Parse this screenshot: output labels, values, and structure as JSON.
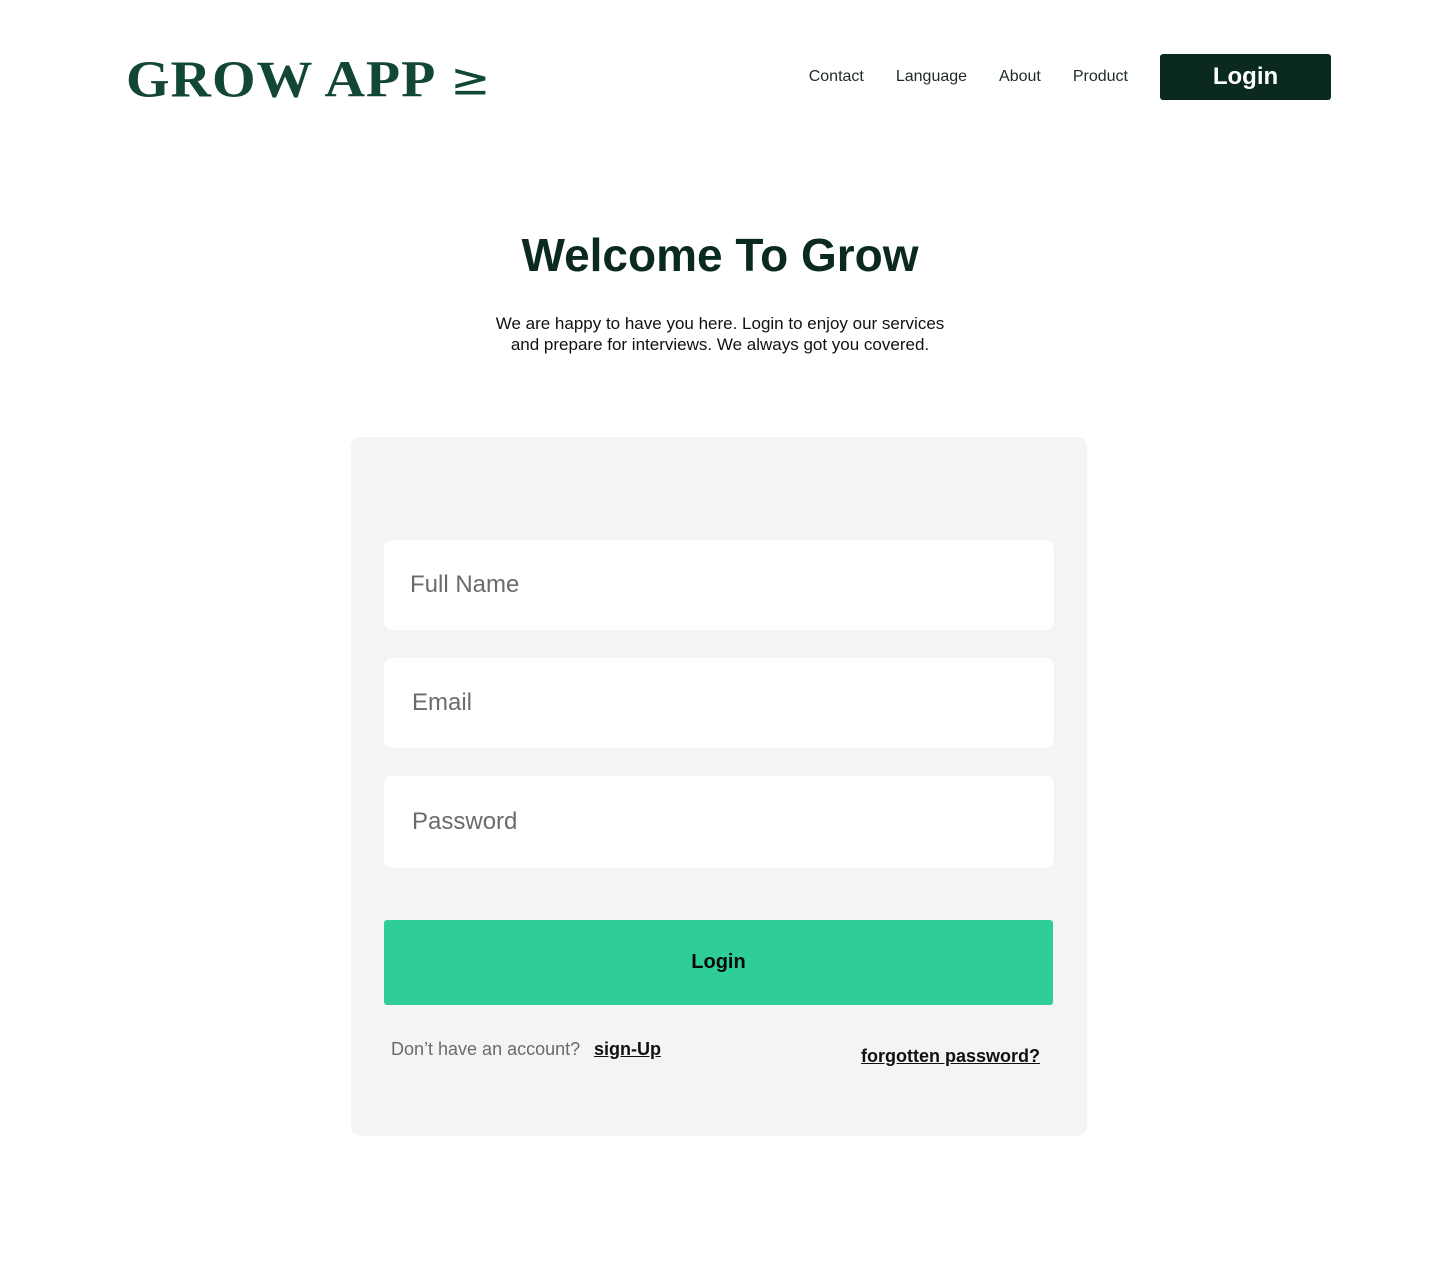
{
  "header": {
    "logo_text": "GROW APP",
    "logo_glyph": "≥",
    "nav": [
      {
        "label": "Contact"
      },
      {
        "label": "Language"
      },
      {
        "label": "About"
      },
      {
        "label": "Product"
      }
    ],
    "login_label": "Login"
  },
  "hero": {
    "title": "Welcome To Grow",
    "subtitle_line1": "We are happy to have you here. Login to enjoy our services",
    "subtitle_line2": "and prepare for interviews. We always got you covered."
  },
  "form": {
    "full_name_placeholder": "Full Name",
    "email_placeholder": "Email",
    "password_placeholder": "Password",
    "submit_label": "Login",
    "no_account_text": "Don’t have an account?",
    "signup_label": "sign-Up",
    "forgot_label": "forgotten password?"
  },
  "colors": {
    "brand_dark": "#0a2a1e",
    "logo_green": "#124734",
    "accent": "#2ecd9a",
    "card_bg": "#f4f4f4"
  }
}
